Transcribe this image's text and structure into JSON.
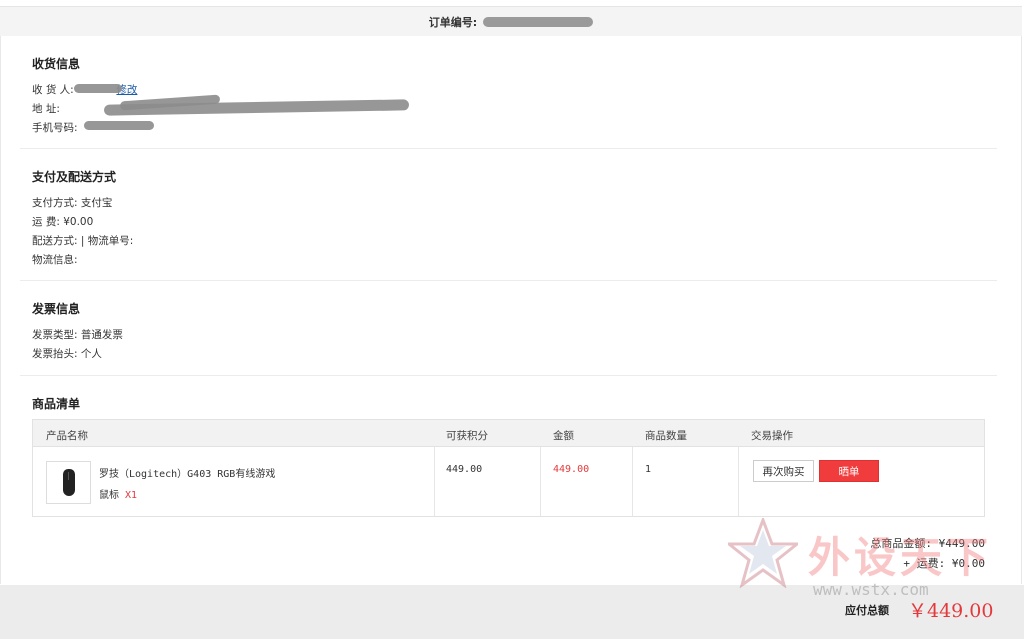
{
  "order": {
    "number_label": "订单编号:"
  },
  "shipping": {
    "title": "收货信息",
    "receiver_label": "收 货 人:",
    "edit_link": "修改",
    "address_label": "地          址:",
    "phone_label": "手机号码:"
  },
  "payment": {
    "title": "支付及配送方式",
    "method": "支付方式: 支付宝",
    "fee": "运 费: ¥0.00",
    "delivery": "配送方式: | 物流单号:",
    "logistics": "物流信息:"
  },
  "invoice": {
    "title": "发票信息",
    "type": "发票类型: 普通发票",
    "header": "发票抬头: 个人"
  },
  "goods": {
    "title": "商品清单",
    "headers": {
      "name": "产品名称",
      "points": "可获积分",
      "amount": "金额",
      "qty": "商品数量",
      "ops": "交易操作"
    },
    "items": [
      {
        "name_line1": "罗技（Logitech）G403 RGB有线游戏",
        "name_line2": "鼠标",
        "qty_badge": "X1",
        "points": "449.00",
        "amount": "449.00",
        "quantity": "1",
        "btn_again": "再次购买",
        "btn_share": "晒单"
      }
    ]
  },
  "summary": {
    "goods_total": "总商品金额: ¥449.00",
    "freight": "+ 运费: ¥0.00",
    "payable_label": "应付总额",
    "payable_value": "￥449.00"
  },
  "watermark": {
    "text": "外设天下",
    "url": "www.wstx.com"
  },
  "colors": {
    "accent_red": "#e4393c",
    "button_red": "#f03c3c",
    "link_blue": "#1a5aa6"
  }
}
